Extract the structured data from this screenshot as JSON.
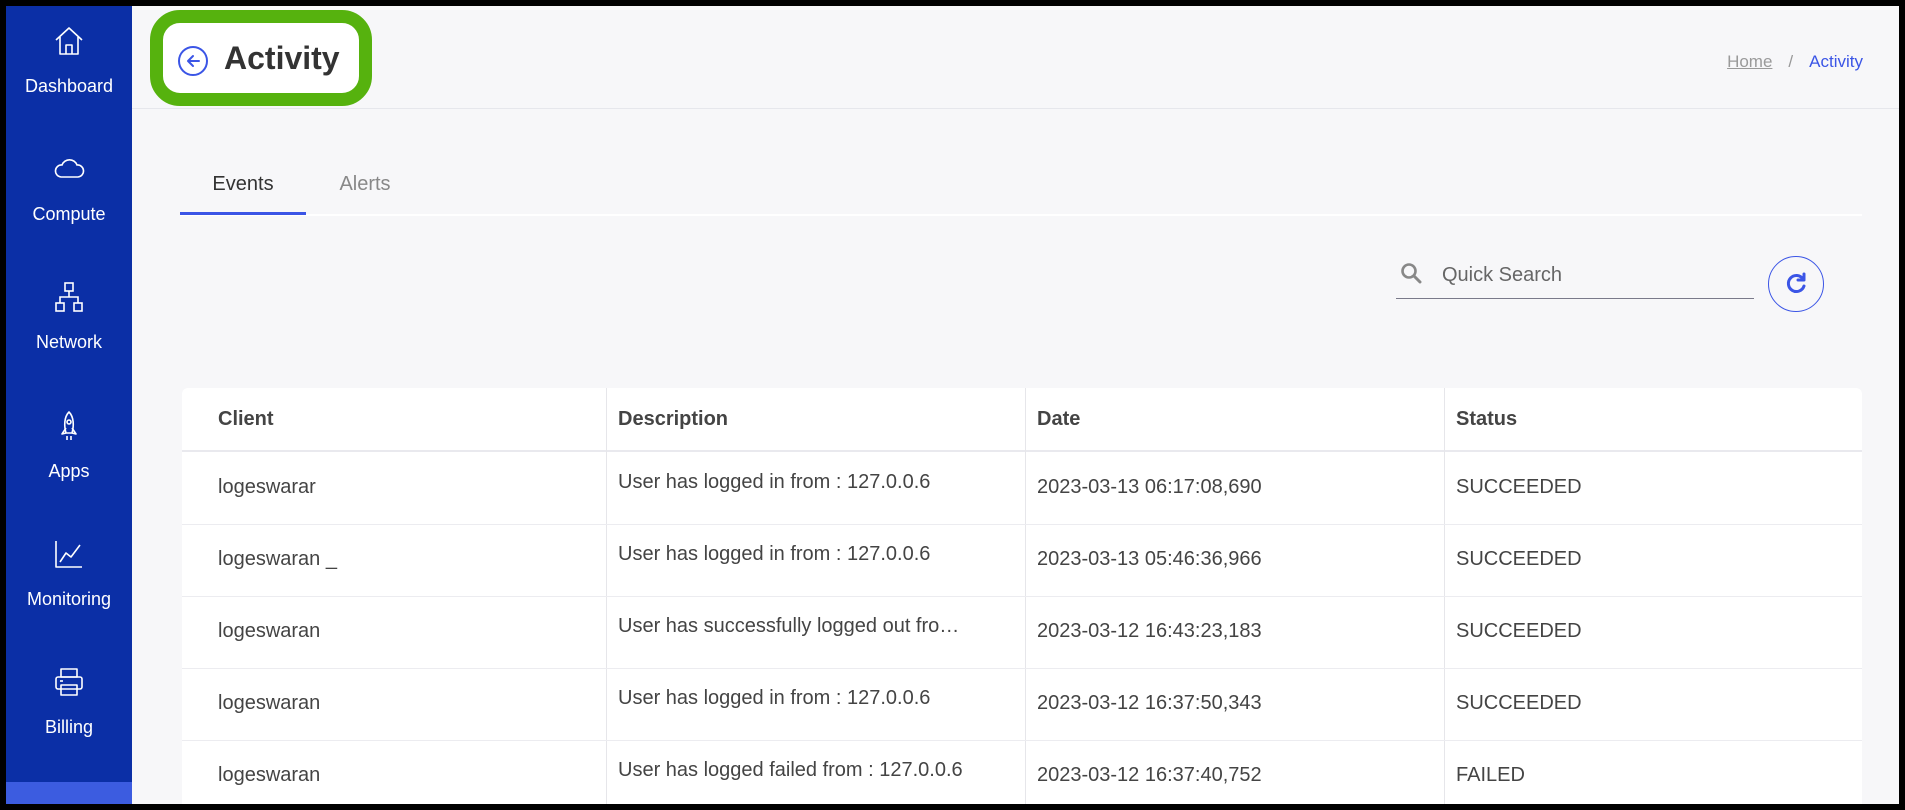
{
  "sidebar": {
    "items": [
      {
        "label": "Dashboard",
        "icon": "home-icon"
      },
      {
        "label": "Compute",
        "icon": "cloud-icon"
      },
      {
        "label": "Network",
        "icon": "network-icon"
      },
      {
        "label": "Apps",
        "icon": "rocket-icon"
      },
      {
        "label": "Monitoring",
        "icon": "chart-icon"
      },
      {
        "label": "Billing",
        "icon": "printer-icon"
      }
    ]
  },
  "header": {
    "title": "Activity",
    "breadcrumb": {
      "home": "Home",
      "separator": "/",
      "current": "Activity"
    }
  },
  "tabs": [
    {
      "label": "Events",
      "active": true
    },
    {
      "label": "Alerts",
      "active": false
    }
  ],
  "search": {
    "placeholder": "Quick Search",
    "value": ""
  },
  "table": {
    "columns": [
      "Client",
      "Description",
      "Date",
      "Status"
    ],
    "rows": [
      {
        "client": "logeswarar",
        "description": "User has logged in from : 127.0.0.6",
        "date": "2023-03-13 06:17:08,690",
        "status": "SUCCEEDED"
      },
      {
        "client": "logeswaran _",
        "description": "User has logged in from : 127.0.0.6",
        "date": "2023-03-13 05:46:36,966",
        "status": "SUCCEEDED"
      },
      {
        "client": "logeswaran",
        "description": "User has successfully logged out fro…",
        "date": "2023-03-12 16:43:23,183",
        "status": "SUCCEEDED"
      },
      {
        "client": "logeswaran",
        "description": "User has logged in from : 127.0.0.6",
        "date": "2023-03-12 16:37:50,343",
        "status": "SUCCEEDED"
      },
      {
        "client": "logeswaran",
        "description": "User has logged failed from : 127.0.0.6",
        "date": "2023-03-12 16:37:40,752",
        "status": "FAILED"
      }
    ]
  },
  "colors": {
    "sidebar": "#0b2fa6",
    "accent": "#3b55e6",
    "highlight": "#56b20e"
  }
}
